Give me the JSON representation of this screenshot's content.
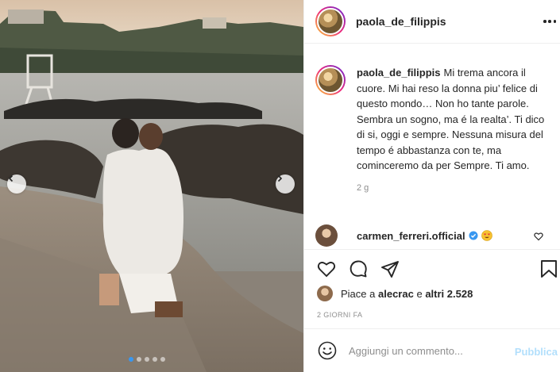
{
  "post": {
    "author": "paola_de_filippis",
    "caption": "Mi trema ancora il cuore. Mi hai reso la donna piu’ felice di questo mondo… Non ho tante parole. Sembra un sogno, ma é la realta’. Ti dico di si, oggi e sempre. Nessuna misura del tempo é abbastanza con te, ma cominceremo da per Sempre. Ti amo.",
    "caption_age": "2 g",
    "likes_prefix": "Piace a",
    "likes_user": "alecrac",
    "likes_joiner": "e",
    "likes_count": "altri 2.528",
    "date": "2 GIORNI FA",
    "slides_total": 5,
    "slide_active": 1
  },
  "comment": {
    "author": "carmen_ferreri.official",
    "verified_icon": "verified-badge-icon",
    "emoji": "heart-eyes-emoji"
  },
  "composer": {
    "placeholder": "Aggiungi un commento...",
    "submit_label": "Pubblica"
  },
  "colors": {
    "verified": "#3897f0",
    "publish_disabled": "#b2dffc",
    "muted_text": "#8e8e8e"
  },
  "icons": [
    "more-options-icon",
    "heart-icon",
    "comment-icon",
    "share-icon",
    "bookmark-icon",
    "smile-icon",
    "chevron-left-icon",
    "chevron-right-icon"
  ]
}
